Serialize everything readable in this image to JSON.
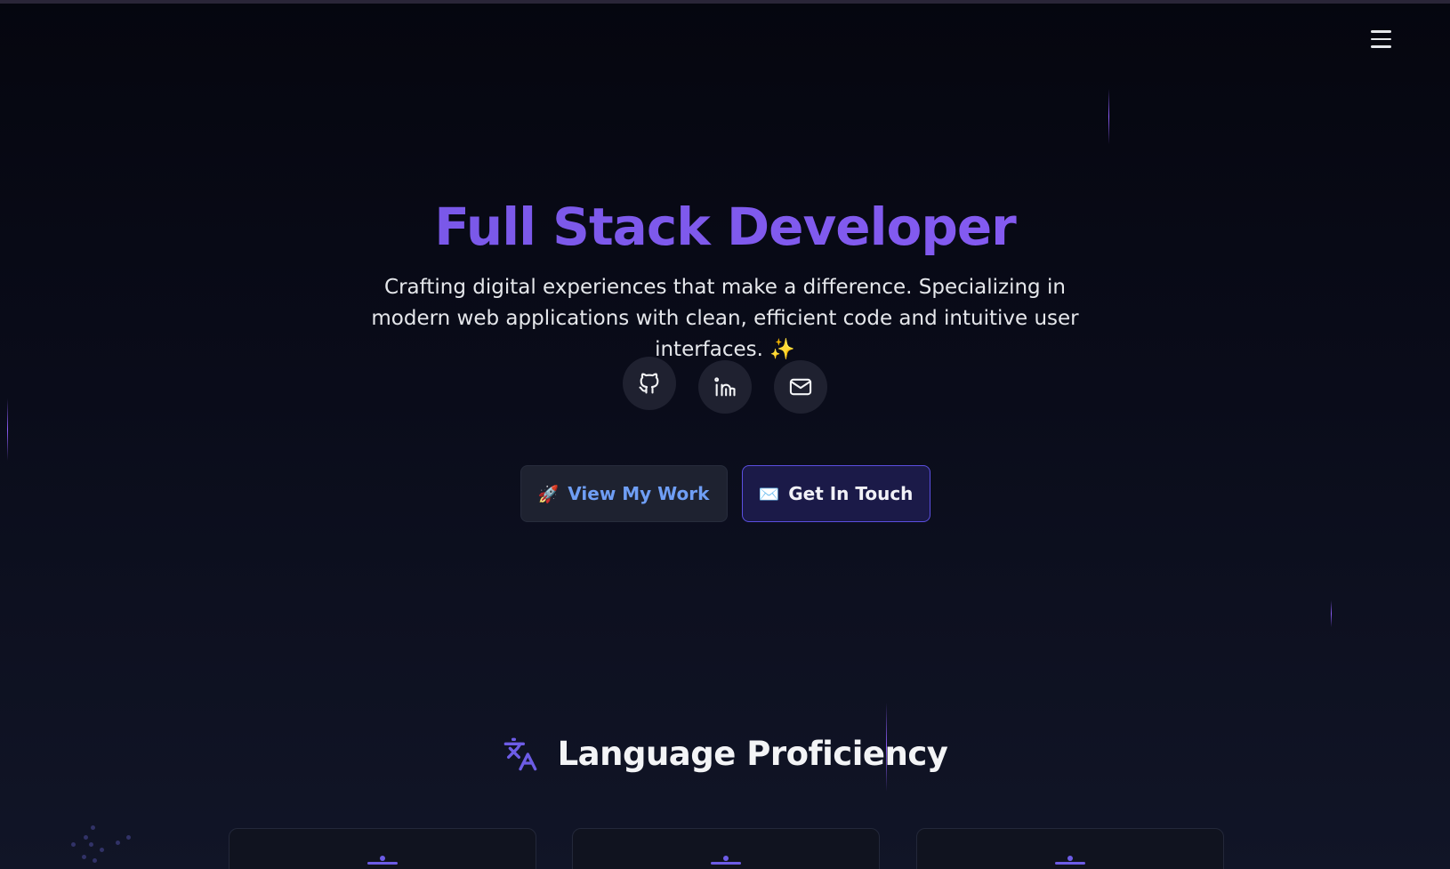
{
  "header": {
    "menu_icon": "hamburger-menu-icon"
  },
  "hero": {
    "title": "Full Stack Developer",
    "subtitle": "Crafting digital experiences that make a difference. Specializing in modern web applications with clean, efficient code and intuitive user interfaces. ✨",
    "socials": [
      {
        "icon": "github-icon"
      },
      {
        "icon": "linkedin-icon"
      },
      {
        "icon": "mail-icon"
      }
    ],
    "buttons": {
      "work_emoji": "🚀",
      "work_label": "View My Work",
      "touch_emoji": "✉️",
      "touch_label": "Get In Touch"
    }
  },
  "section": {
    "icon": "translate-icon",
    "title": "Language Proficiency"
  },
  "colors": {
    "accent": "#8b5cf6",
    "work_text": "#6f9ef5",
    "touch_border": "#5b4fe0"
  }
}
